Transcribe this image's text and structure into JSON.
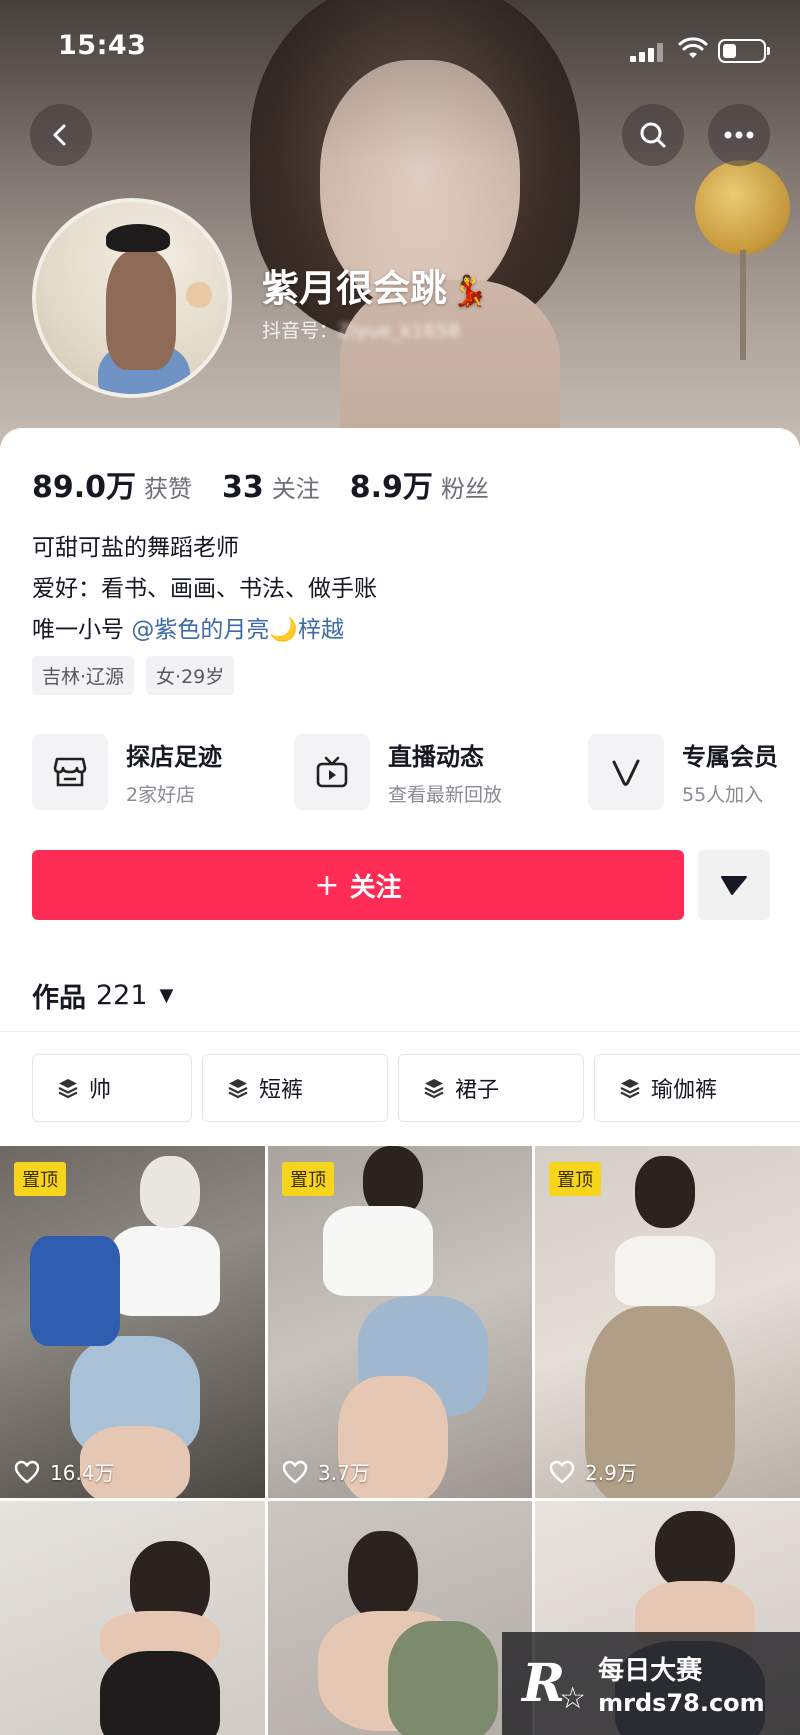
{
  "status_bar": {
    "time": "15:43",
    "battery_level": 0.35
  },
  "profile": {
    "nickname": "紫月很会跳",
    "nickname_emoji": "💃",
    "douyin_id_label": "抖音号：",
    "douyin_id_value": "Ziyue_k1658",
    "stats": [
      {
        "value": "89.0万",
        "label": "获赞"
      },
      {
        "value": "33",
        "label": "关注"
      },
      {
        "value": "8.9万",
        "label": "粉丝"
      }
    ],
    "bio": {
      "line1": "可甜可盐的舞蹈老师",
      "line2": "爱好：看书、画画、书法、做手账",
      "line3_prefix": "唯一小号",
      "line3_mention": "@紫色的月亮🌙梓越"
    },
    "tags": [
      "吉林·辽源",
      "女·29岁"
    ]
  },
  "features": [
    {
      "title": "探店足迹",
      "subtitle": "2家好店",
      "icon": "store-icon"
    },
    {
      "title": "直播动态",
      "subtitle": "查看最新回放",
      "icon": "tv-icon"
    },
    {
      "title": "专属会员",
      "subtitle": "55人加入",
      "icon": "vip-v-icon"
    }
  ],
  "actions": {
    "follow_plus": "+",
    "follow_label": "关注",
    "more_icon": "triangle-down-icon"
  },
  "works": {
    "label": "作品",
    "count": "221",
    "caret": "▼"
  },
  "collections": [
    "帅",
    "短裤",
    "裙子",
    "瑜伽裤"
  ],
  "videos": [
    {
      "pinned": true,
      "pin_label": "置顶",
      "likes": "16.4万"
    },
    {
      "pinned": true,
      "pin_label": "置顶",
      "likes": "3.7万"
    },
    {
      "pinned": true,
      "pin_label": "置顶",
      "likes": "2.9万"
    },
    {
      "pinned": false,
      "likes": ""
    },
    {
      "pinned": false,
      "likes": ""
    },
    {
      "pinned": false,
      "likes": ""
    }
  ],
  "watermark": {
    "logo": "R",
    "line1": "每日大赛",
    "line2": "mrds78.com"
  },
  "colors": {
    "accent": "#fe2c55",
    "pin": "#f7d51d",
    "mention": "#3f6aa6"
  }
}
